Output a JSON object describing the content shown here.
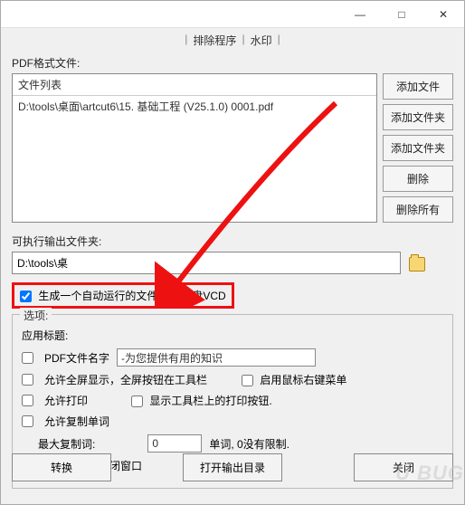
{
  "titlebar": {
    "min": "—",
    "max": "□",
    "close": "✕"
  },
  "tabs": {
    "t1": "排除程序",
    "t2": "水印"
  },
  "labels": {
    "pdfFiles": "PDF格式文件:",
    "fileListHeader": "文件列表",
    "fileRow": "D:\\tools\\桌面\\artcut6\\15. 基础工程 (V25.1.0) 0001.pdf",
    "outFolder": "可执行输出文件夹:",
    "outPath": "D:\\tools\\桌",
    "autorun": "生成一个自动运行的文件/ dvd光盘VCD",
    "options": "选项:",
    "appTitle": "应用标题:",
    "pdfName": "PDF文件名字",
    "pdfNameVal": "-为您提供有用的知识",
    "fullscreen": "允许全屏显示，全屏按钮在工具栏",
    "rightClick": "启用鼠标右键菜单",
    "allowPrint": "允许打印",
    "showPrintBtn": "显示工具栏上的打印按钮.",
    "allowCopy": "允许复制单词",
    "maxCopy": "最大复制词:",
    "maxCopyVal": "0",
    "unit": "单词,  0没有限制.",
    "closeAfterOpen": "打开网站后关闭窗口"
  },
  "sidebtns": {
    "add": "添加文件",
    "addFolder": "添加文件夹",
    "addFolder2": "添加文件夹",
    "del": "删除",
    "delAll": "删除所有"
  },
  "bottom": {
    "convert": "转换",
    "openOut": "打开输出目录",
    "close": "关闭"
  },
  "watermark": "U BUG"
}
